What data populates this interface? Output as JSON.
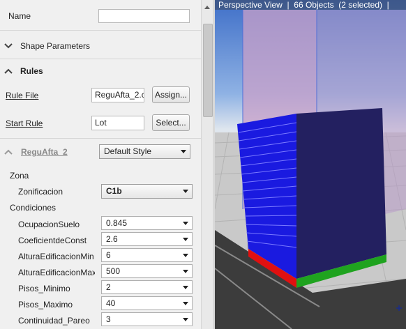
{
  "inspector": {
    "name_label": "Name",
    "name_value": "",
    "shape_parameters_label": "Shape Parameters",
    "rules_label": "Rules",
    "rule_file_label": "Rule File",
    "rule_file_value": "ReguAfta_2.c",
    "assign_button": "Assign...",
    "start_rule_label": "Start Rule",
    "start_rule_value": "Lot",
    "select_button": "Select...",
    "rule_group_label": "ReguAfta_2",
    "style_value": "Default Style",
    "zona_label": "Zona",
    "zonificacion_label": "Zonificacion",
    "zonificacion_value": "C1b",
    "condiciones_label": "Condiciones",
    "attributes": [
      {
        "label": "OcupacionSuelo",
        "value": "0.845"
      },
      {
        "label": "CoeficientdeConst",
        "value": "2.6"
      },
      {
        "label": "AlturaEdificacionMin",
        "value": "6"
      },
      {
        "label": "AlturaEdificacionMax",
        "value": "500"
      },
      {
        "label": "Pisos_Minimo",
        "value": "2"
      },
      {
        "label": "Pisos_Maximo",
        "value": "40"
      },
      {
        "label": "Continuidad_Pareo",
        "value": "3"
      }
    ]
  },
  "viewport": {
    "title": "Perspective View  |  66 Objects  (2 selected)  |"
  },
  "colors": {
    "building_front": "#232060",
    "building_side": "#1a1ae0",
    "building_base_red": "#e01010",
    "building_base_green": "#1fa31f",
    "envelope": "#c9a0c8",
    "sky_top": "#3f6fc8",
    "ground": "#c9c9c9"
  }
}
